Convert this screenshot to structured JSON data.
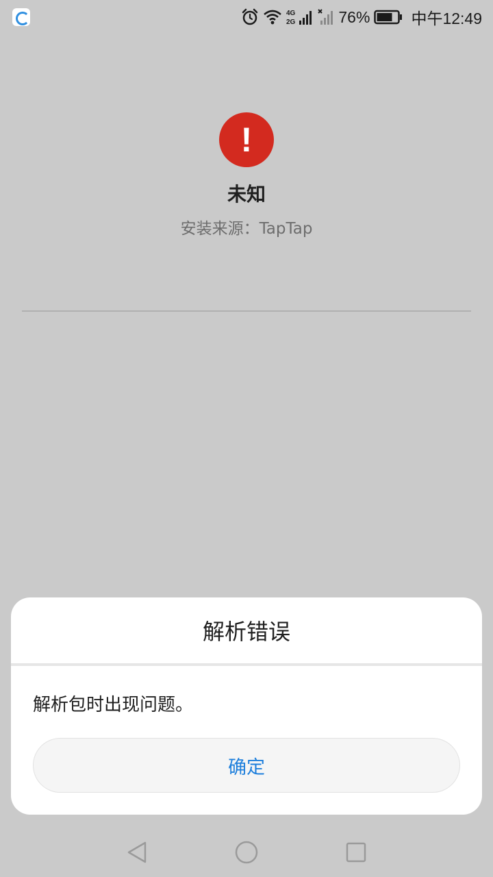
{
  "status_bar": {
    "app_icon": "browser-notification-icon",
    "icons": [
      "alarm-icon",
      "wifi-icon",
      "signal-4g-icon",
      "signal-no-sim-icon",
      "battery-icon"
    ],
    "network_top": "4G",
    "network_bottom": "2G",
    "battery_percent": "76%",
    "battery_level": 0.76,
    "clock": "中午12:49"
  },
  "app_info": {
    "alert_icon": "exclamation-icon",
    "alert_glyph": "!",
    "name": "未知",
    "install_source": "安装来源：TapTap"
  },
  "dialog": {
    "title": "解析错误",
    "message": "解析包时出现问题。",
    "confirm_label": "确定"
  },
  "nav_bar": {
    "icons": [
      "back-icon",
      "home-icon",
      "recent-apps-icon"
    ]
  },
  "colors": {
    "background": "#cacaca",
    "alert_red": "#d32a1f",
    "accent_blue": "#1e7fdc"
  }
}
